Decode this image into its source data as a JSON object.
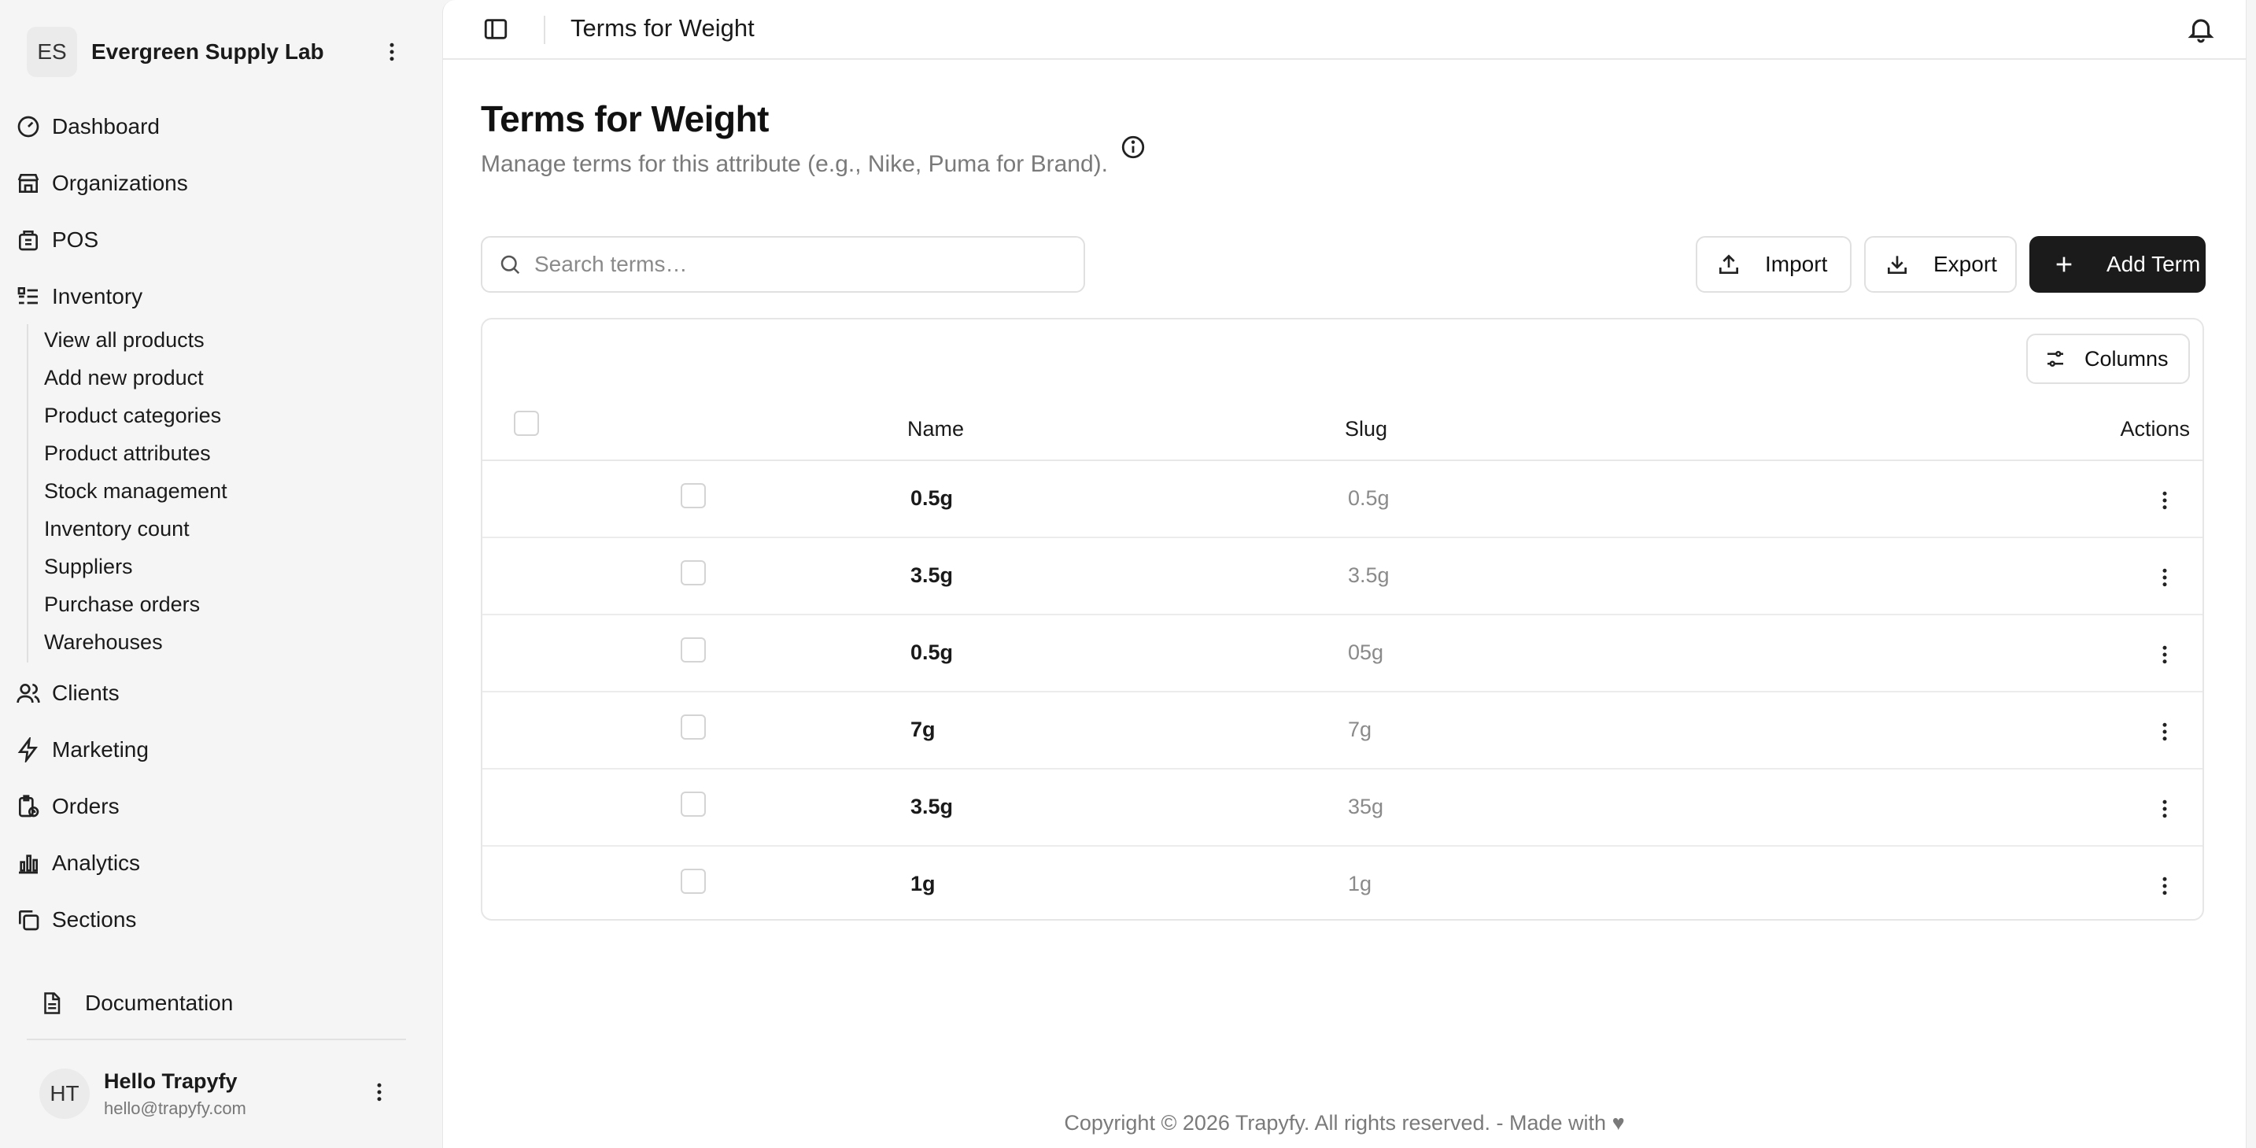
{
  "org": {
    "initials": "ES",
    "name": "Evergreen Supply Lab"
  },
  "nav": {
    "dashboard": "Dashboard",
    "organizations": "Organizations",
    "pos": "POS",
    "inventory": "Inventory",
    "clients": "Clients",
    "marketing": "Marketing",
    "orders": "Orders",
    "analytics": "Analytics",
    "sections": "Sections",
    "documentation": "Documentation"
  },
  "inventory_sub": [
    "View all products",
    "Add new product",
    "Product categories",
    "Product attributes",
    "Stock management",
    "Inventory count",
    "Suppliers",
    "Purchase orders",
    "Warehouses"
  ],
  "user": {
    "initials": "HT",
    "name": "Hello Trapyfy",
    "email": "hello@trapyfy.com"
  },
  "topbar": {
    "title": "Terms for Weight"
  },
  "page": {
    "title": "Terms for Weight",
    "subtitle": "Manage terms for this attribute (e.g., Nike, Puma for Brand)."
  },
  "search": {
    "placeholder": "Search terms…",
    "value": ""
  },
  "actions": {
    "import": "Import",
    "export": "Export",
    "add": "Add Term"
  },
  "table": {
    "columns_button": "Columns",
    "headers": {
      "name": "Name",
      "slug": "Slug",
      "actions": "Actions"
    },
    "rows": [
      {
        "name": "0.5g",
        "slug": "0.5g"
      },
      {
        "name": "3.5g",
        "slug": "3.5g"
      },
      {
        "name": "0.5g",
        "slug": "05g"
      },
      {
        "name": "7g",
        "slug": "7g"
      },
      {
        "name": "3.5g",
        "slug": "35g"
      },
      {
        "name": "1g",
        "slug": "1g"
      }
    ]
  },
  "footer": {
    "text": "Copyright © 2026 Trapyfy. All rights reserved. - Made with ♥"
  },
  "colors": {
    "primary_button": "#1b1b1b",
    "sidebar_bg": "#f5f5f5",
    "muted_text": "#7a7a7a"
  }
}
